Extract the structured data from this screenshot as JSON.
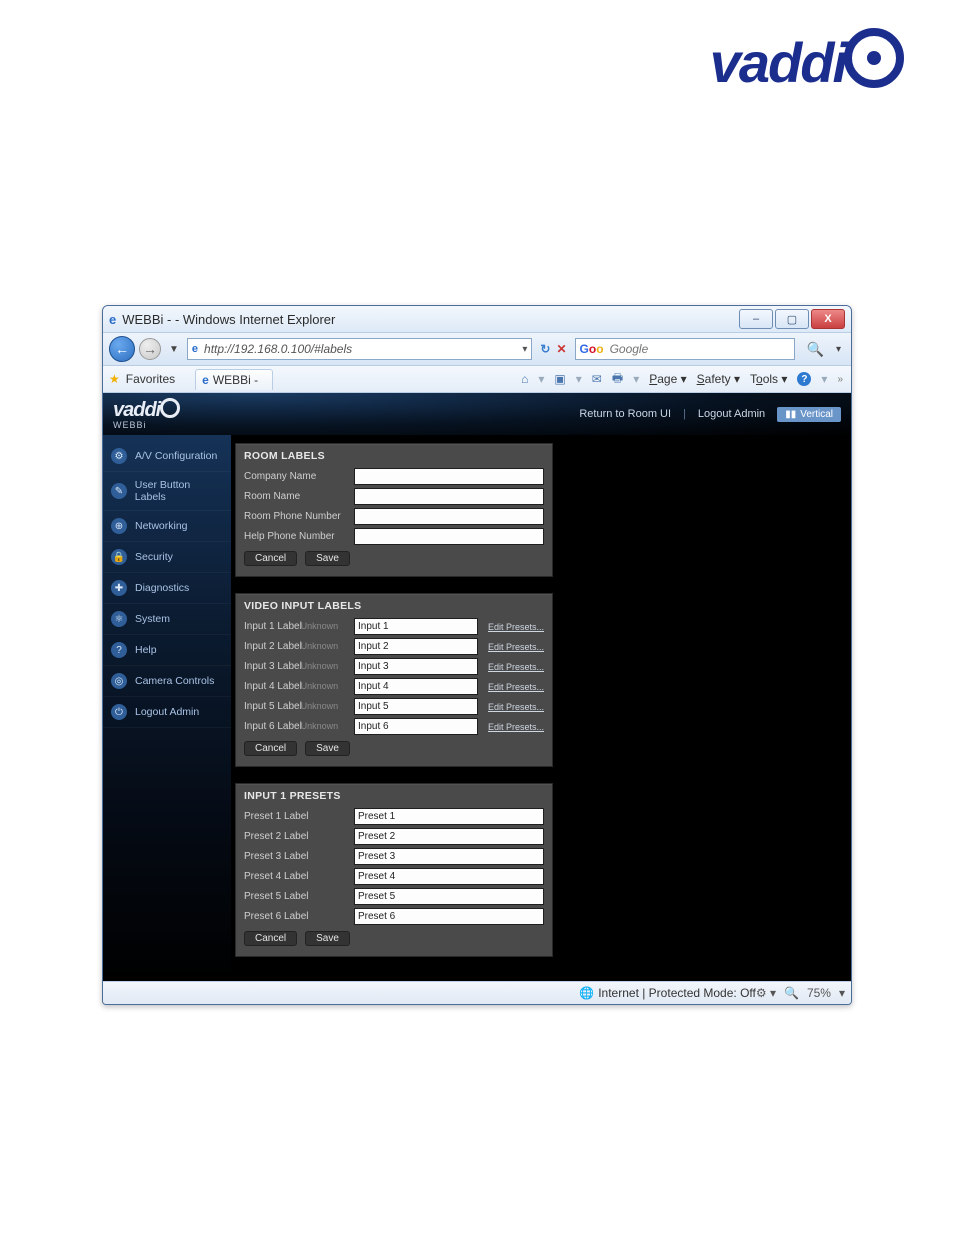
{
  "window": {
    "title": "WEBBi - - Windows Internet Explorer",
    "minimize_icon": "–",
    "maximize_icon": "▢",
    "close_icon": "X"
  },
  "address": {
    "url": "http://192.168.0.100/#labels",
    "search_placeholder": "Google"
  },
  "favorites": {
    "label": "Favorites",
    "tab_label": "WEBBi -"
  },
  "command_bar": {
    "page": "Page",
    "safety": "Safety",
    "tools": "Tools"
  },
  "app": {
    "logo_text": "vaddi",
    "logo_sub": "WEBBi",
    "return_link": "Return to Room UI",
    "logout_link": "Logout Admin",
    "vertical_label": "Vertical"
  },
  "sidebar": {
    "items": [
      {
        "label": "A/V Configuration"
      },
      {
        "label": "User Button Labels"
      },
      {
        "label": "Networking"
      },
      {
        "label": "Security"
      },
      {
        "label": "Diagnostics"
      },
      {
        "label": "System"
      },
      {
        "label": "Help"
      },
      {
        "label": "Camera Controls"
      },
      {
        "label": "Logout Admin"
      }
    ]
  },
  "room_labels": {
    "heading": "ROOM LABELS",
    "fields": [
      {
        "label": "Company Name",
        "value": ""
      },
      {
        "label": "Room Name",
        "value": ""
      },
      {
        "label": "Room Phone Number",
        "value": ""
      },
      {
        "label": "Help Phone Number",
        "value": ""
      }
    ],
    "cancel": "Cancel",
    "save": "Save"
  },
  "video_inputs": {
    "heading": "VIDEO INPUT LABELS",
    "hint": "Unknown",
    "edit": "Edit Presets...",
    "rows": [
      {
        "label": "Input 1 Label",
        "value": "Input 1"
      },
      {
        "label": "Input 2 Label",
        "value": "Input 2"
      },
      {
        "label": "Input 3 Label",
        "value": "Input 3"
      },
      {
        "label": "Input 4 Label",
        "value": "Input 4"
      },
      {
        "label": "Input 5 Label",
        "value": "Input 5"
      },
      {
        "label": "Input 6 Label",
        "value": "Input 6"
      }
    ],
    "cancel": "Cancel",
    "save": "Save"
  },
  "presets": {
    "heading": "INPUT 1 PRESETS",
    "rows": [
      {
        "label": "Preset 1 Label",
        "value": "Preset 1"
      },
      {
        "label": "Preset 2 Label",
        "value": "Preset 2"
      },
      {
        "label": "Preset 3 Label",
        "value": "Preset 3"
      },
      {
        "label": "Preset 4 Label",
        "value": "Preset 4"
      },
      {
        "label": "Preset 5 Label",
        "value": "Preset 5"
      },
      {
        "label": "Preset 6 Label",
        "value": "Preset 6"
      }
    ],
    "cancel": "Cancel",
    "save": "Save"
  },
  "status": {
    "text": "Internet | Protected Mode: Off",
    "zoom": "75%"
  }
}
